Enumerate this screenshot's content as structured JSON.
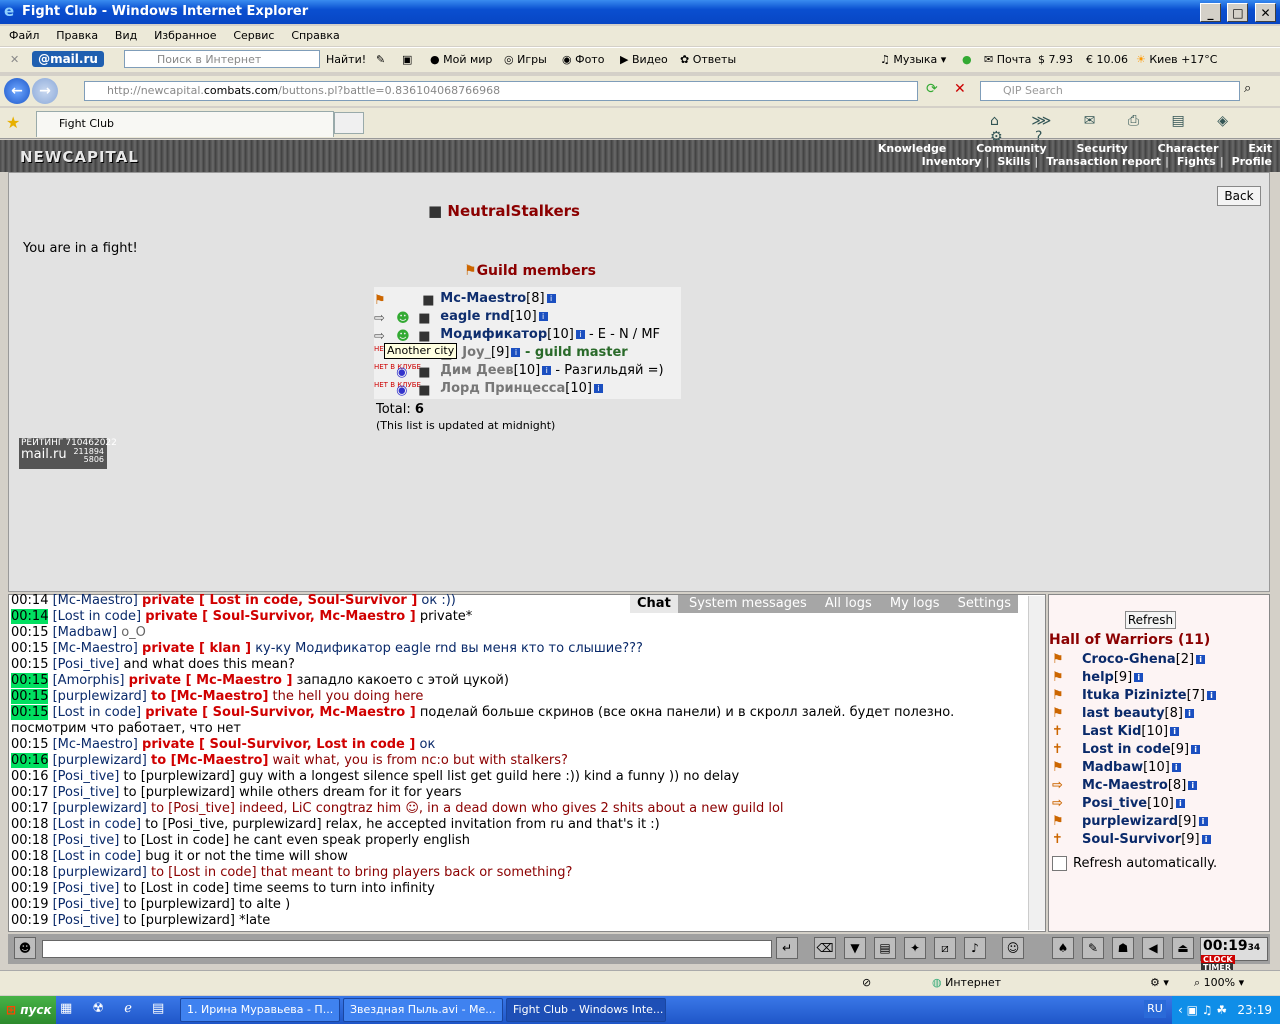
{
  "window": {
    "title": "Fight Club - Windows Internet Explorer",
    "buttons": [
      "0",
      "1",
      "r"
    ]
  },
  "menubar": [
    "Файл",
    "Правка",
    "Вид",
    "Избранное",
    "Сервис",
    "Справка"
  ],
  "toolbar": {
    "brand": "@mail.ru",
    "search_placeholder": "Поиск в Интернет",
    "find": "Найти!",
    "items": [
      "Мой мир",
      "Игры",
      "Фото",
      "Видео",
      "Ответы"
    ],
    "right_items": [
      "Музыка",
      "Почта",
      "$ 7.93",
      "€ 10.06",
      "Киев +17°C"
    ]
  },
  "nav": {
    "url_prefix": "http://newcapital.",
    "url_host": "combats.com",
    "url_rest": "/buttons.pl?battle=0.836104068766968",
    "qip_placeholder": "QIP Search"
  },
  "tab": {
    "label": "Fight Club"
  },
  "game": {
    "logo": "NEWCAPITAL",
    "nav_top": [
      "Knowledge",
      "Community",
      "Security",
      "Character",
      "Exit"
    ],
    "nav_bottom": [
      "Inventory",
      "Skills",
      "Transaction report",
      "Fights",
      "Profile"
    ]
  },
  "page": {
    "guild_name": "NeutralStalkers",
    "notice": "You are in a fight!",
    "back": "Back",
    "members_title": "Guild members",
    "members": [
      {
        "name": "Mc-Maestro",
        "level": "[8]",
        "note": "",
        "online": true
      },
      {
        "name": "eagle rnd",
        "level": "[10]",
        "note": "",
        "online": true
      },
      {
        "name": "Модификатор",
        "level": "[10]",
        "note": " - E - N / MF",
        "online": true
      },
      {
        "name": "Joy_",
        "level": "[9]",
        "note": " - guild master",
        "online": false
      },
      {
        "name": "Дим Деев",
        "level": "[10]",
        "note": " - Разгильдяй =)",
        "online": false
      },
      {
        "name": "Лорд Принцесса",
        "level": "[10]",
        "note": "",
        "online": false
      }
    ],
    "tooltip": "Another city",
    "total_label": "Total:",
    "total_value": "6",
    "updated": "(This list is updated at midnight)",
    "rating_label": "РЕЙТИНГ",
    "rating_value1": "710462022",
    "rating_brand": "mail.ru",
    "rating_value2": "211894",
    "rating_value3": "5806",
    "offline_badge": "НЕТ В КЛУБЕ"
  },
  "chat": {
    "tabs": [
      "Chat",
      "System messages",
      "All logs",
      "My logs",
      "Settings"
    ],
    "lines": [
      {
        "time": "00:14",
        "hl": false,
        "nick": "[Mc-Maestro]",
        "priv": "private [ Lost in code, Soul-Survivor ]",
        "to": "",
        "text": " ок :))",
        "style": "blue"
      },
      {
        "time": "00:14",
        "hl": true,
        "nick": "[Lost in code]",
        "priv": "private [ Soul-Survivor, Mc-Maestro ]",
        "to": "",
        "text": " private*",
        "style": "plain"
      },
      {
        "time": "00:15",
        "hl": false,
        "nick": "[Madbaw]",
        "priv": "",
        "to": "",
        "text": " o_O",
        "style": "gray"
      },
      {
        "time": "00:15",
        "hl": false,
        "nick": "[Mc-Maestro]",
        "priv": "private [ klan ]",
        "to": "",
        "text": " ку-ку Модификатор eagle rnd вы меня кто то слышие???",
        "style": "blue"
      },
      {
        "time": "00:15",
        "hl": false,
        "nick": "[Posi_tive]",
        "priv": "",
        "to": "",
        "text": " and what does this mean?",
        "style": "plain"
      },
      {
        "time": "00:15",
        "hl": true,
        "nick": "[Amorphis]",
        "priv": "private [ Mc-Maestro ]",
        "to": "",
        "text": " западло какоето с этой цукой)",
        "style": "plain"
      },
      {
        "time": "00:15",
        "hl": true,
        "nick": "[purplewizard]",
        "priv": "",
        "to": "to [Mc-Maestro]",
        "text": " the hell you doing here",
        "style": "red"
      },
      {
        "time": "00:15",
        "hl": true,
        "nick": "[Lost in code]",
        "priv": "private [ Soul-Survivor, Mc-Maestro ]",
        "to": "",
        "text": " поделай больше скринов (все окна панели) и в скролл залей. будет полезно.",
        "style": "plain"
      },
      {
        "time": "",
        "hl": false,
        "nick": "",
        "priv": "",
        "to": "",
        "text": "посмотрим что работает, что нет",
        "style": "plain"
      },
      {
        "time": "00:15",
        "hl": false,
        "nick": "[Mc-Maestro]",
        "priv": "private [ Soul-Survivor, Lost in code ]",
        "to": "",
        "text": " ок",
        "style": "blue"
      },
      {
        "time": "00:16",
        "hl": true,
        "nick": "[purplewizard]",
        "priv": "",
        "to": "to [Mc-Maestro]",
        "text": " wait what, you is from nc:o but with stalkers?",
        "style": "red"
      },
      {
        "time": "00:16",
        "hl": false,
        "nick": "[Posi_tive]",
        "priv": "",
        "to": "",
        "text": " to [purplewizard] guy with a longest silence spell list get guild here :)) kind a funny )) no delay",
        "style": "plain"
      },
      {
        "time": "00:17",
        "hl": false,
        "nick": "[Posi_tive]",
        "priv": "",
        "to": "",
        "text": " to [purplewizard] while others dream for it for years",
        "style": "plain"
      },
      {
        "time": "00:17",
        "hl": false,
        "nick": "[purplewizard]",
        "priv": "",
        "to": "",
        "text": " to [Posi_tive] indeed, LiC congtraz him ☺, in a dead down who gives 2 shits about a new guild lol",
        "style": "red"
      },
      {
        "time": "00:18",
        "hl": false,
        "nick": "[Lost in code]",
        "priv": "",
        "to": "",
        "text": " to [Posi_tive, purplewizard] relax, he accepted invitation from ru and that's it :)",
        "style": "plain"
      },
      {
        "time": "00:18",
        "hl": false,
        "nick": "[Posi_tive]",
        "priv": "",
        "to": "",
        "text": " to [Lost in code] he cant even speak properly english",
        "style": "plain"
      },
      {
        "time": "00:18",
        "hl": false,
        "nick": "[Lost in code]",
        "priv": "",
        "to": "",
        "text": " bug it or not the time will show",
        "style": "plain"
      },
      {
        "time": "00:18",
        "hl": false,
        "nick": "[purplewizard]",
        "priv": "",
        "to": "",
        "text": " to [Lost in code] that meant to bring players back or something?",
        "style": "red"
      },
      {
        "time": "00:19",
        "hl": false,
        "nick": "[Posi_tive]",
        "priv": "",
        "to": "",
        "text": " to [Lost in code] time seems to turn into infinity",
        "style": "plain"
      },
      {
        "time": "00:19",
        "hl": false,
        "nick": "[Posi_tive]",
        "priv": "",
        "to": "",
        "text": " to [purplewizard] to alte )",
        "style": "plain"
      },
      {
        "time": "00:19",
        "hl": false,
        "nick": "[Posi_tive]",
        "priv": "",
        "to": "",
        "text": " to [purplewizard] *late",
        "style": "plain"
      }
    ]
  },
  "hall": {
    "refresh": "Refresh",
    "title": "Hall of Warriors (11)",
    "warriors": [
      {
        "name": "Croco-Ghena",
        "level": "[2]"
      },
      {
        "name": "help",
        "level": "[9]"
      },
      {
        "name": "Ituka Pizinizte",
        "level": "[7]"
      },
      {
        "name": "last beauty",
        "level": "[8]"
      },
      {
        "name": "Last Kid",
        "level": "[10]"
      },
      {
        "name": "Lost in code",
        "level": "[9]"
      },
      {
        "name": "Madbaw",
        "level": "[10]"
      },
      {
        "name": "Mc-Maestro",
        "level": "[8]"
      },
      {
        "name": "Posi_tive",
        "level": "[10]"
      },
      {
        "name": "purplewizard",
        "level": "[9]"
      },
      {
        "name": "Soul-Survivor",
        "level": "[9]"
      }
    ],
    "auto": "Refresh automatically."
  },
  "clock": {
    "time": "00:19",
    "seconds": "34",
    "label1": "CLOCK",
    "label2": "TIMER"
  },
  "statusbar": {
    "zone": "Интернет",
    "zoom": "100%"
  },
  "taskbar": {
    "start": "пуск",
    "tasks": [
      "1. Ирина Муравьева - П...",
      "Звездная Пыль.avi - Me...",
      "Fight Club - Windows Inte..."
    ],
    "lang": "RU",
    "time": "23:19"
  }
}
